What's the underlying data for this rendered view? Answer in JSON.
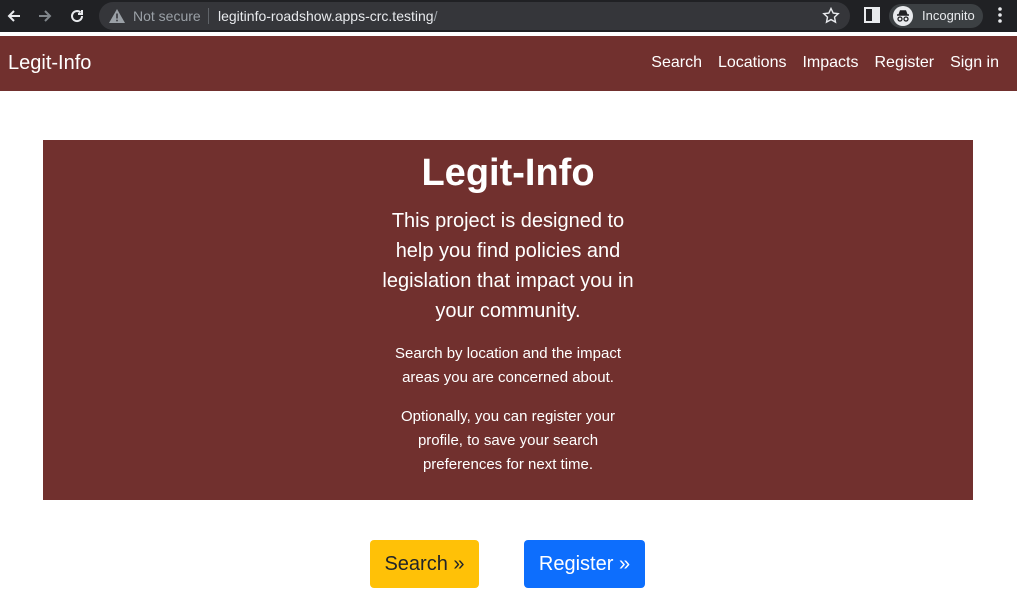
{
  "browser": {
    "security_label": "Not secure",
    "url_host": "legitinfo-roadshow.apps-crc.testing",
    "url_path": "/",
    "incognito_label": "Incognito",
    "icons": [
      "back-icon",
      "forward-icon",
      "reload-icon",
      "warning-icon",
      "star-icon",
      "side-panel-icon",
      "incognito-icon",
      "more-icon"
    ]
  },
  "navbar": {
    "brand": "Legit-Info",
    "links": [
      "Search",
      "Locations",
      "Impacts",
      "Register",
      "Sign in"
    ]
  },
  "hero": {
    "title": "Legit-Info",
    "lead": "This project is designed to help you find policies and legislation that impact you in your community.",
    "p1": "Search by location and the impact areas you are concerned about.",
    "p2": "Optionally, you can register your profile, to save your search preferences for next time."
  },
  "actions": {
    "search_label": "Search »",
    "register_label": "Register »"
  },
  "colors": {
    "brand": "#71302e",
    "search_button": "#ffc107",
    "register_button": "#0d6efd",
    "chrome": "#202124"
  }
}
